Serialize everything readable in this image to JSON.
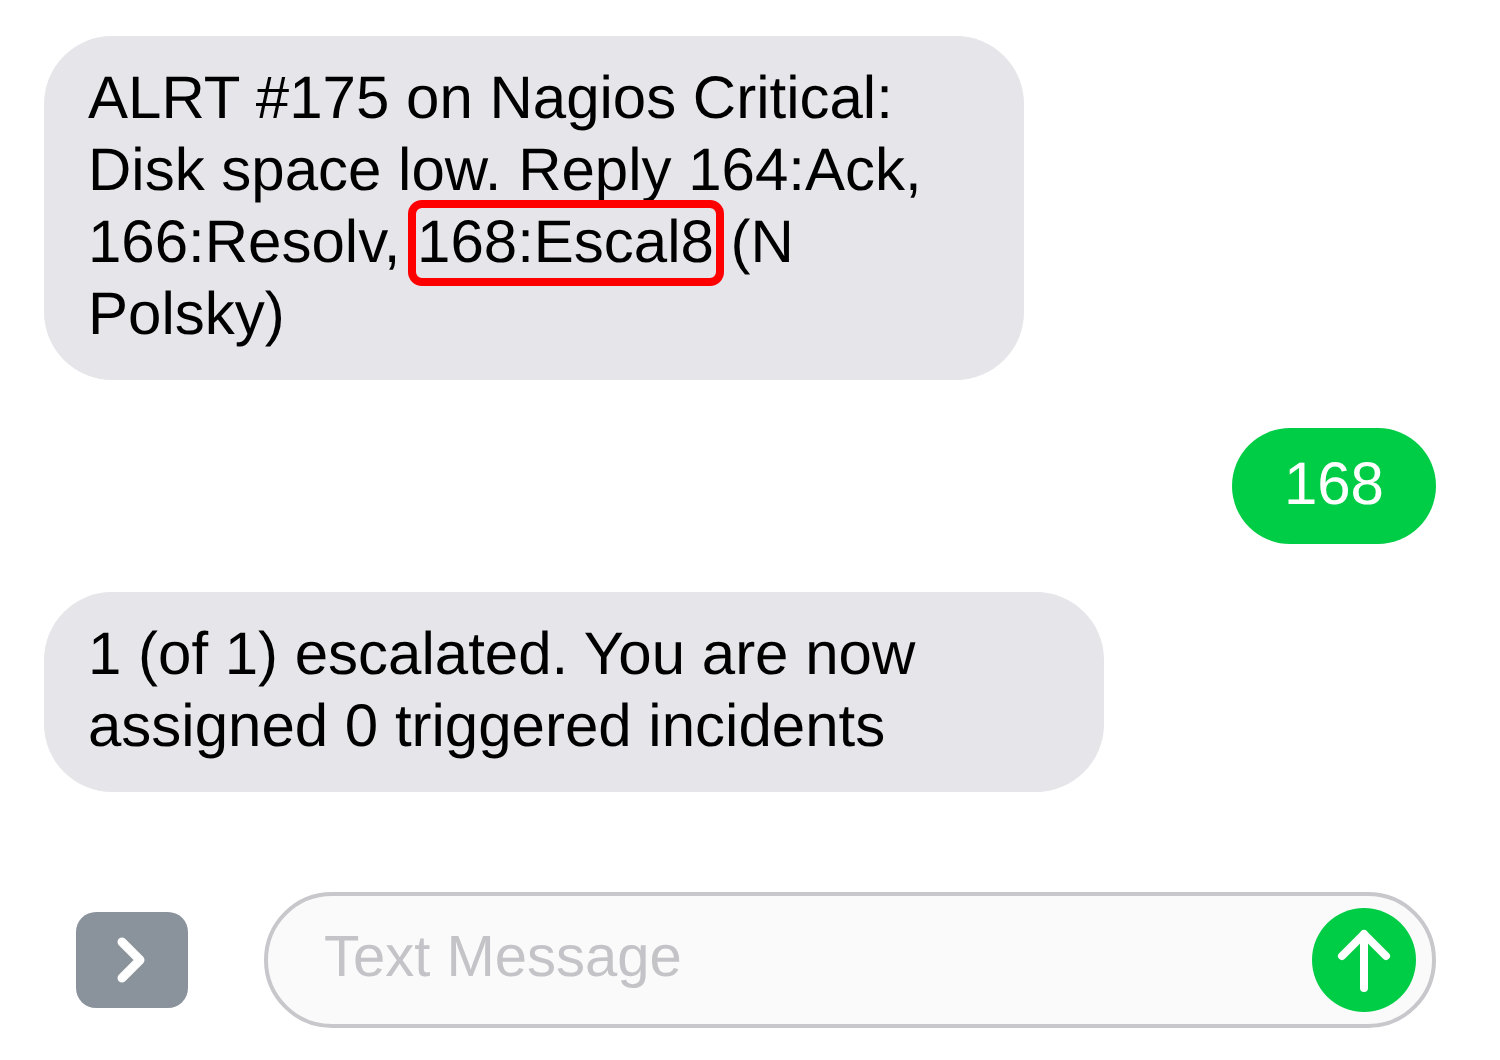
{
  "messages": [
    {
      "kind": "incoming",
      "segments": [
        {
          "text": "ALRT #175 on Nagios Critical: Disk space low. Reply 164:Ack, 166:Resolv, ",
          "highlighted": false
        },
        {
          "text": "168:Escal8",
          "highlighted": true
        },
        {
          "text": " (N Polsky)",
          "highlighted": false
        }
      ]
    },
    {
      "kind": "outgoing",
      "segments": [
        {
          "text": "168",
          "highlighted": false
        }
      ]
    },
    {
      "kind": "incoming",
      "segments": [
        {
          "text": "1 (of 1) escalated. You are now assigned 0 triggered incidents",
          "highlighted": false
        }
      ]
    }
  ],
  "composer": {
    "placeholder": "Text Message"
  }
}
